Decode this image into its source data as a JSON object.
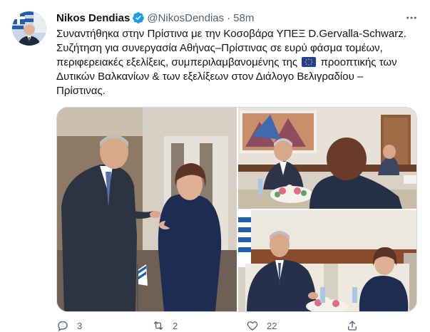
{
  "author": {
    "name": "Nikos Dendias",
    "handle": "@NikosDendias",
    "separator": "·",
    "time": "58m",
    "verified": true
  },
  "tweet": {
    "lines": [
      "Συναντήθηκα στην Πρίστινα με την Κοσοβάρα ΥΠΕΞ D.Gervalla-Schwarz.",
      "Συζήτηση για συνεργασία Αθήνας–Πρίστινας σε ευρύ φάσμα τομέων,",
      "περιφερειακές εξελίξεις, συμπεριλαμβανομένης της",
      "προοπτικής των",
      "Δυτικών Βαλκανίων & των εξελίξεων στον Διάλογο Βελιγραδίου –",
      "Πρίστινας."
    ],
    "emoji": "eu-flag"
  },
  "media": {
    "photos": [
      "photo-1",
      "photo-2",
      "photo-3"
    ]
  },
  "actions": {
    "reply_count": "3",
    "retweet_count": "2",
    "like_count": "22"
  },
  "icons": {
    "reply": "reply-icon",
    "retweet": "retweet-icon",
    "like": "heart-icon",
    "share": "share-icon",
    "more": "more-icon"
  },
  "colors": {
    "text": "#0f1419",
    "secondary": "#536471",
    "verified": "#1d9bf0",
    "border": "#cfd9de"
  }
}
